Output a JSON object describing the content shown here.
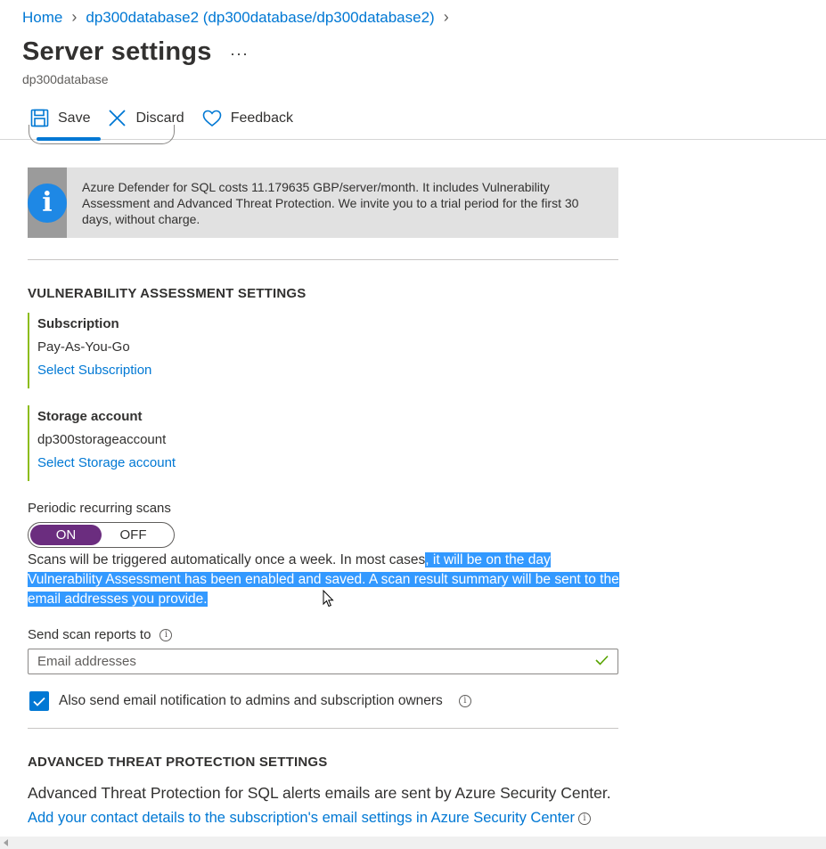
{
  "breadcrumb": {
    "home": "Home",
    "database": "dp300database2 (dp300database/dp300database2)"
  },
  "page": {
    "title": "Server settings",
    "more": "···",
    "subtitle": "dp300database"
  },
  "toolbar": {
    "save_label": "Save",
    "discard_label": "Discard",
    "feedback_label": "Feedback"
  },
  "info_banner": {
    "text": "Azure Defender for SQL costs 11.179635 GBP/server/month. It includes Vulnerability Assessment and Advanced Threat Protection. We invite you to a trial period for the first 30 days, without charge."
  },
  "va_settings": {
    "title": "VULNERABILITY ASSESSMENT SETTINGS",
    "subscription": {
      "label": "Subscription",
      "value": "Pay-As-You-Go",
      "link": "Select Subscription"
    },
    "storage": {
      "label": "Storage account",
      "value": "dp300storageaccount",
      "link": "Select Storage account"
    },
    "periodic_scans": {
      "label": "Periodic recurring scans",
      "on_label": "ON",
      "off_label": "OFF",
      "state": "ON"
    },
    "scan_desc_plain": "Scans will be triggered automatically once a week. In most cases",
    "scan_desc_selected": ", it will be on the day Vulnerability Assessment has been enabled and saved. A scan result summary will be sent to the email addresses you provide.",
    "send_reports": {
      "label": "Send scan reports to",
      "placeholder": "Email addresses",
      "value": ""
    },
    "notify_admins": {
      "label": "Also send email notification to admins and subscription owners",
      "checked": true
    }
  },
  "atp_settings": {
    "title": "ADVANCED THREAT PROTECTION SETTINGS",
    "text": "Advanced Threat Protection for SQL alerts emails are sent by Azure Security Center.",
    "link": "Add your contact details to the subscription's email settings in Azure Security Center"
  },
  "colors": {
    "link": "#0078d4",
    "toggle_on": "#6b2d7f",
    "group_accent": "#8cbd18",
    "selection": "#3399ff",
    "info_icon": "#1e88e5"
  },
  "icons": {
    "save": "save-icon",
    "discard": "close-icon",
    "feedback": "heart-icon",
    "info": "info-icon",
    "check": "checkmark-icon"
  }
}
